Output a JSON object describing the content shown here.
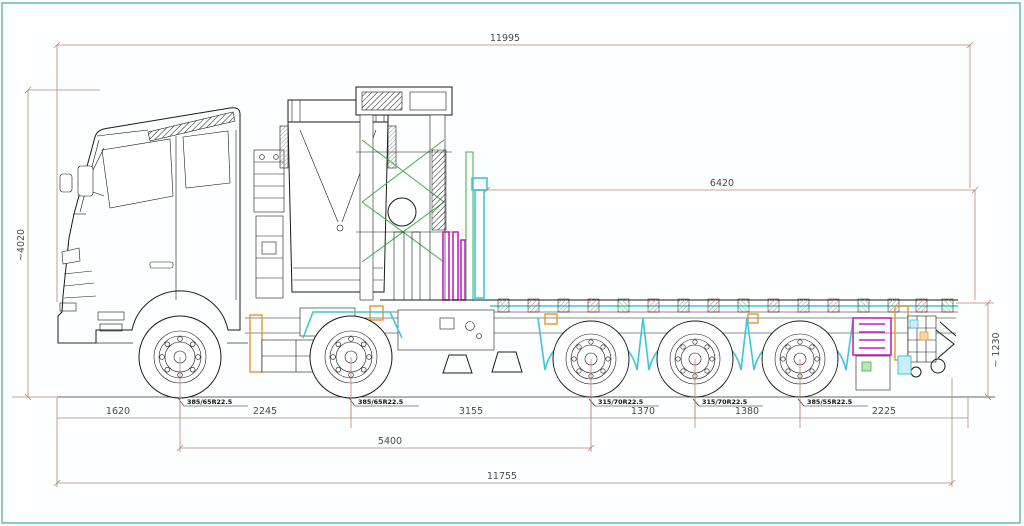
{
  "dimensions_mm": {
    "top_overall": "11995",
    "body_length": "6420",
    "overall_height": "~4020",
    "rear_deck_height": "~ 1230",
    "front_overhang": "1620",
    "axle1_to_axle2": "2245",
    "axle2_to_axle3": "3155",
    "axle3_to_axle4": "1370",
    "axle4_to_axle5": "1380",
    "rear_overhang": "2225",
    "axle1_to_axle3": "5400",
    "bottom_overall": "11755"
  },
  "tire_labels": {
    "axle1": "385/65R22.5",
    "axle2": "385/65R22.5",
    "axle3": "315/70R22.5",
    "axle4": "315/70R22.5",
    "axle5": "385/55R22.5"
  },
  "colors": {
    "dimension_line": "#b5857c",
    "dimension_text": "#4a4a4a",
    "outline_black": "#1a1a1a",
    "suspension_cyan": "#3ec6d8",
    "equipment_magenta": "#c224c2",
    "crane_green": "#3fae46",
    "tank_orange": "#e8952f",
    "hatch_red": "#d97f7f",
    "border_teal": "#62b2b5"
  }
}
